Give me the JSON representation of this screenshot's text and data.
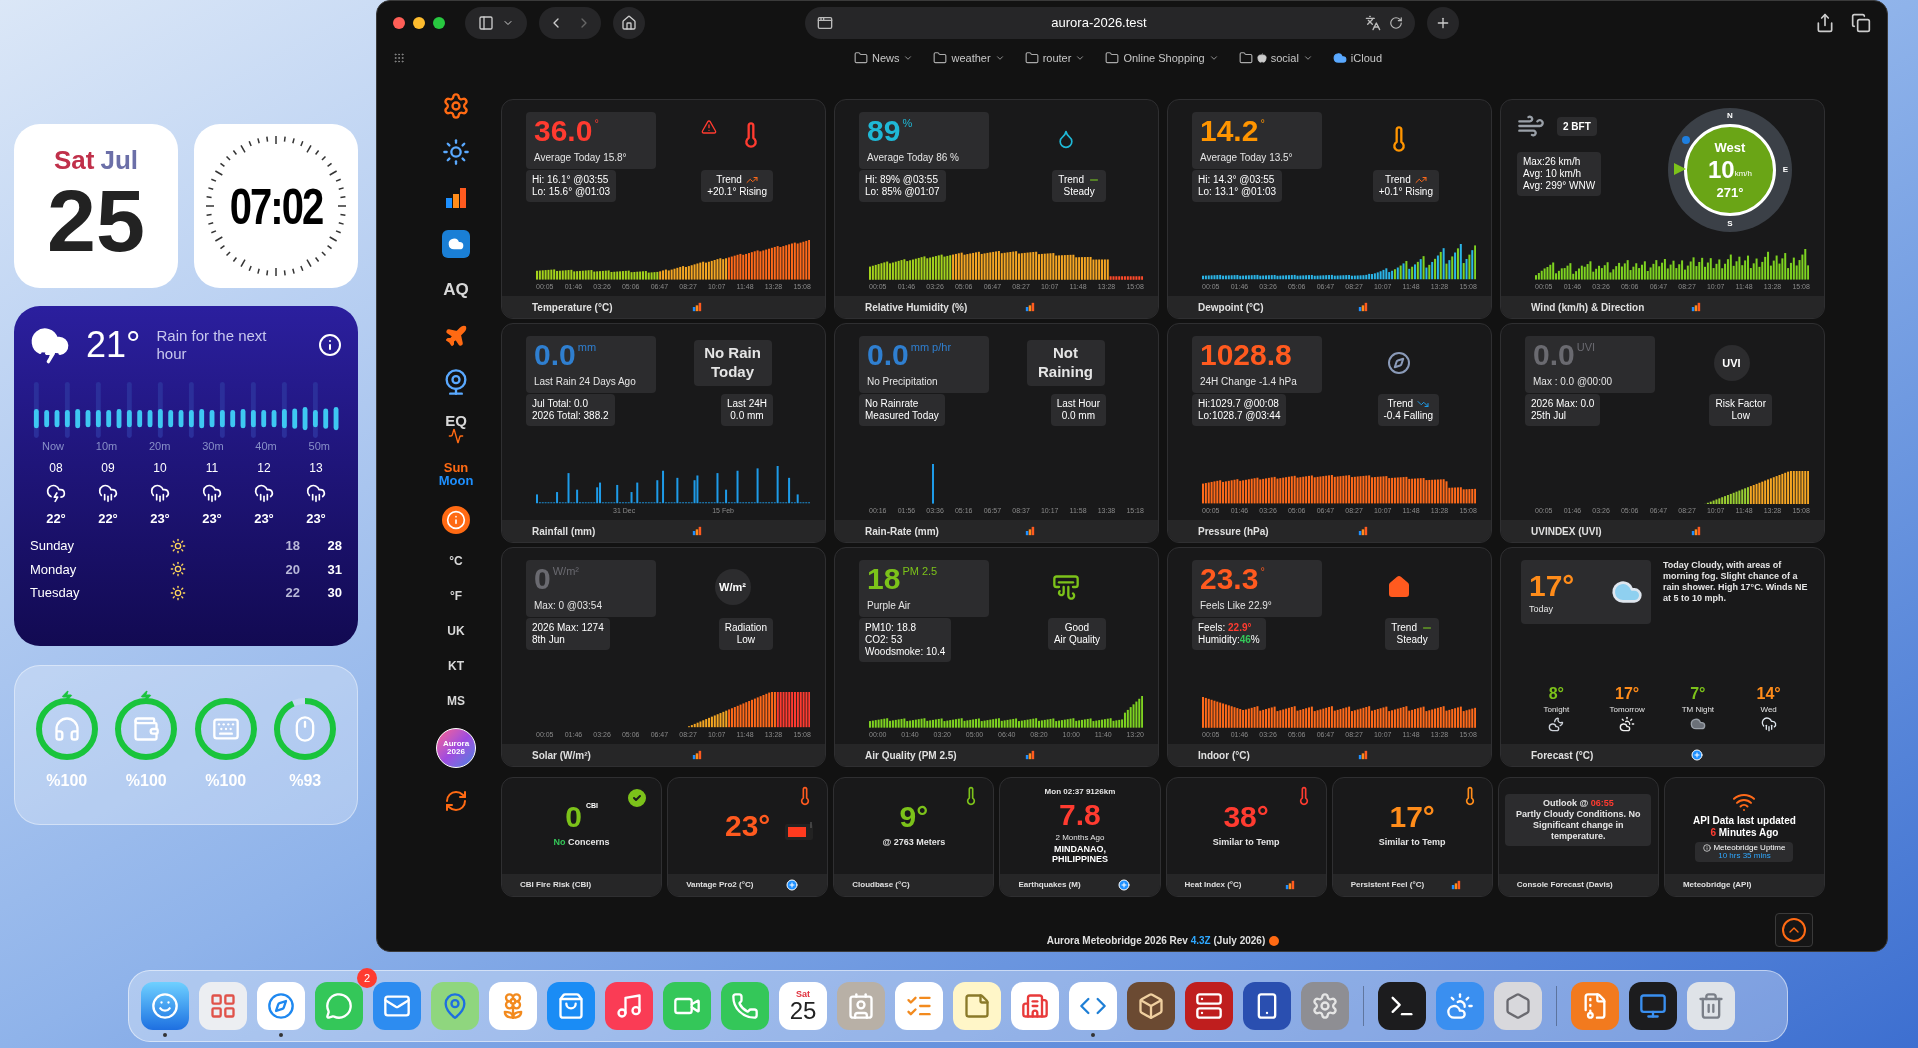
{
  "desktop": {
    "calendar_widget": {
      "weekday": "Sat",
      "month": "Jul",
      "day": "25"
    },
    "clock_widget": {
      "time": "07:02"
    },
    "weather_widget": {
      "kind": "thunder",
      "temperature": "21°",
      "summary": "Rain for the next hour",
      "minute_labels": [
        "Now",
        "10m",
        "20m",
        "30m",
        "40m",
        "50m"
      ],
      "hours": [
        {
          "hour": "08",
          "kind": "thunder",
          "temp": "22°"
        },
        {
          "hour": "09",
          "kind": "rain",
          "temp": "22°"
        },
        {
          "hour": "10",
          "kind": "rain",
          "temp": "23°"
        },
        {
          "hour": "11",
          "kind": "rain",
          "temp": "23°"
        },
        {
          "hour": "12",
          "kind": "rain",
          "temp": "23°"
        },
        {
          "hour": "13",
          "kind": "rain",
          "temp": "23°"
        }
      ],
      "days": [
        {
          "day": "Sunday",
          "kind": "sun",
          "low": "18",
          "high": "28"
        },
        {
          "day": "Monday",
          "kind": "sun",
          "low": "20",
          "high": "31"
        },
        {
          "day": "Tuesday",
          "kind": "sun",
          "low": "22",
          "high": "30"
        }
      ]
    },
    "battery_widget": {
      "devices": [
        {
          "kind": "earbuds",
          "level": 1,
          "charging": true,
          "percent": "%100"
        },
        {
          "kind": "case",
          "level": 1,
          "charging": true,
          "percent": "%100"
        },
        {
          "kind": "keyboard",
          "level": 1,
          "charging": false,
          "percent": "%100"
        },
        {
          "kind": "mouse",
          "level": 0.93,
          "charging": false,
          "percent": "%93"
        }
      ]
    }
  },
  "browser": {
    "address": "aurora-2026.test",
    "bookmarks": [
      {
        "kind": "folder",
        "label": "News"
      },
      {
        "kind": "folder",
        "label": "weather"
      },
      {
        "kind": "folder",
        "label": "router"
      },
      {
        "kind": "folder",
        "label": "Online Shopping"
      },
      {
        "kind": "apple-folder",
        "label": "social"
      },
      {
        "kind": "link",
        "label": "iCloud"
      }
    ],
    "sidebar": [
      {
        "kind": "gear"
      },
      {
        "kind": "sun"
      },
      {
        "kind": "chart"
      },
      {
        "kind": "cloud"
      },
      {
        "kind": "label",
        "text": "AQ"
      },
      {
        "kind": "plane"
      },
      {
        "kind": "camera"
      },
      {
        "kind": "quake",
        "text": "EQ"
      },
      {
        "kind": "sunmoon",
        "lines": [
          "Sun",
          "Moon"
        ]
      },
      {
        "kind": "info"
      },
      {
        "kind": "unit",
        "text": "°C"
      },
      {
        "kind": "unit",
        "text": "°F"
      },
      {
        "kind": "unit",
        "text": "UK"
      },
      {
        "kind": "unit",
        "text": "KT"
      },
      {
        "kind": "unit",
        "text": "MS"
      },
      {
        "kind": "avatar",
        "lines": [
          "Aurora",
          "2026"
        ]
      },
      {
        "kind": "refresh"
      }
    ],
    "cards": [
      {
        "kind": "main",
        "value": "36.0",
        "unit": "°",
        "color": "#ff3b30",
        "caption": "Average Today 15.8°",
        "badge": {
          "kind": "temp-alert"
        },
        "stats": [
          "Hi: 16.1° @03:55",
          "Lo: 15.6° @01:03"
        ],
        "side": {
          "kind": "trend-up",
          "lines": [
            "Trend",
            "+20.1° Rising"
          ]
        },
        "times": [
          "00:05",
          "01:46",
          "03:26",
          "05:06",
          "06:47",
          "08:27",
          "10:07",
          "11:48",
          "13:28",
          "15:08"
        ],
        "title": "Temperature (°C)"
      },
      {
        "kind": "main",
        "value": "89",
        "unit": "%",
        "color": "#1fb8d6",
        "caption": "Average Today 86 %",
        "badge": {
          "kind": "drop"
        },
        "stats": [
          "Hi: 89% @03:55",
          "Lo: 85% @01:07"
        ],
        "side": {
          "kind": "trend-flat",
          "lines": [
            "Trend",
            "Steady"
          ]
        },
        "times": [
          "00:05",
          "01:46",
          "03:26",
          "05:06",
          "06:47",
          "08:27",
          "10:07",
          "11:48",
          "13:28",
          "15:08"
        ],
        "title": "Relative Humidity (%)"
      },
      {
        "kind": "main",
        "value": "14.2",
        "unit": "°",
        "color": "#ff9500",
        "caption": "Average Today 13.5°",
        "badge": {
          "kind": "thermo"
        },
        "stats": [
          "Hi: 14.3° @03:55",
          "Lo: 13.1° @01:03"
        ],
        "side": {
          "kind": "trend-up",
          "lines": [
            "Trend",
            "+0.1° Rising"
          ]
        },
        "times": [
          "00:05",
          "01:46",
          "03:26",
          "05:06",
          "06:47",
          "08:27",
          "10:07",
          "11:48",
          "13:28",
          "15:08"
        ],
        "title": "Dewpoint (°C)"
      },
      {
        "kind": "wind",
        "beaufort": "2 BFT",
        "stats": [
          "Max:26 km/h",
          "Avg: 10 km/h",
          "Avg: 299° WNW"
        ],
        "compass": {
          "north": "N",
          "east": "E",
          "south": "S",
          "direction": "West",
          "speed": "10",
          "unit": "km/h",
          "bearing": "271°"
        },
        "times": [
          "00:05",
          "01:46",
          "03:26",
          "05:06",
          "06:47",
          "08:27",
          "10:07",
          "11:48",
          "13:28",
          "15:08"
        ],
        "title": "Wind (km/h) & Direction"
      },
      {
        "kind": "main",
        "value": "0.0",
        "unit": "mm",
        "color": "#2f7fd0",
        "caption": "Last Rain 24 Days Ago",
        "badge": {
          "kind": "box",
          "text": "No Rain Today"
        },
        "stats": [
          "Jul Total: 0.0",
          "2026 Total: 388.2"
        ],
        "side": {
          "kind": "note",
          "lines": [
            "Last 24H",
            "0.0 mm"
          ]
        },
        "times": [
          "31 Dec",
          "15 Feb"
        ],
        "title": "Rainfall (mm)"
      },
      {
        "kind": "main",
        "value": "0.0",
        "unit": "mm p/hr",
        "color": "#2f7fd0",
        "caption": "No Precipitation",
        "badge": {
          "kind": "box",
          "text": "Not Raining"
        },
        "stats": [
          "No Rainrate",
          "Measured Today"
        ],
        "side": {
          "kind": "note",
          "lines": [
            "Last Hour",
            "0.0 mm"
          ]
        },
        "times": [
          "00:16",
          "01:56",
          "03:36",
          "05:16",
          "06:57",
          "08:37",
          "10:17",
          "11:58",
          "13:38",
          "15:18"
        ],
        "title": "Rain-Rate (mm)"
      },
      {
        "kind": "main",
        "value": "1028.8",
        "color": "#ff5a1f",
        "caption": "24H Change -1.4 hPa",
        "badge": {
          "kind": "gauge"
        },
        "stats": [
          "Hi:1029.7 @00:08",
          "Lo:1028.7 @03:44"
        ],
        "side": {
          "kind": "trend-down",
          "lines": [
            "Trend",
            "-0.4 Falling"
          ]
        },
        "times": [
          "00:05",
          "01:46",
          "03:26",
          "05:06",
          "06:47",
          "08:27",
          "10:07",
          "11:48",
          "13:28",
          "15:08"
        ],
        "title": "Pressure (hPa)"
      },
      {
        "kind": "main",
        "value": "0.0",
        "unit": "UVI",
        "color": "#6a6a70",
        "caption": "Max : 0.0 @00:00",
        "badge": {
          "kind": "circle",
          "text": "UVI"
        },
        "stats": [
          "2026 Max: 0.0",
          "25th Jul"
        ],
        "side": {
          "kind": "note",
          "lines": [
            "Risk Factor",
            "Low"
          ]
        },
        "times": [
          "00:05",
          "01:46",
          "03:26",
          "05:06",
          "06:47",
          "08:27",
          "10:07",
          "11:48",
          "13:28",
          "15:08"
        ],
        "title": "UVINDEX (UVI)"
      },
      {
        "kind": "main",
        "value": "0",
        "unit": "W/m²",
        "color": "#6a6a70",
        "caption": "Max: 0 @03:54",
        "badge": {
          "kind": "circle",
          "text": "W/m²"
        },
        "stats": [
          "2026 Max: 1274",
          "8th Jun"
        ],
        "side": {
          "kind": "note",
          "lines": [
            "Radiation",
            "Low"
          ]
        },
        "times": [
          "00:05",
          "01:46",
          "03:26",
          "05:06",
          "06:47",
          "08:27",
          "10:07",
          "11:48",
          "13:28",
          "15:08"
        ],
        "title": "Solar (W/m²)"
      },
      {
        "kind": "main",
        "value": "18",
        "unit": "PM 2.5",
        "color": "#7cc21a",
        "caption": "Purple Air",
        "badge": {
          "kind": "filter"
        },
        "stats": [
          "PM10: 18.8",
          "CO2: 53",
          "Woodsmoke: 10.4"
        ],
        "side": {
          "kind": "note",
          "lines": [
            "Good",
            "Air Quality"
          ]
        },
        "times": [
          "00:00",
          "01:40",
          "03:20",
          "05:00",
          "06:40",
          "08:20",
          "10:00",
          "11:40",
          "13:20"
        ],
        "title": "Air Quality (PM 2.5)"
      },
      {
        "kind": "main",
        "value": "23.3",
        "unit": "°",
        "color": "#ff5a1f",
        "caption": "Feels Like 22.9°",
        "badge": {
          "kind": "house"
        },
        "stats": [
          [
            {
              "text": "Feels: "
            },
            {
              "text": "22.9°",
              "color": "#ff3b30"
            }
          ],
          [
            {
              "text": "Humidity:"
            },
            {
              "text": "46",
              "color": "#34c759"
            },
            {
              "text": "%"
            }
          ]
        ],
        "side": {
          "kind": "trend-flat",
          "lines": [
            "Trend",
            "Steady"
          ]
        },
        "times": [
          "00:05",
          "01:46",
          "03:26",
          "05:06",
          "06:47",
          "08:27",
          "10:07",
          "11:48",
          "13:28",
          "15:08"
        ],
        "title": "Indoor (°C)"
      },
      {
        "kind": "forecast",
        "value": "17°",
        "value_label": "Today",
        "text": "Today Cloudy, with areas of morning fog. Slight chance of a rain shower. High 17°C. Winds NE at 5 to 10 mph.",
        "periods": [
          {
            "temp": "8°",
            "color": "#7cc21a",
            "label": "Tonight",
            "kind": "moon"
          },
          {
            "temp": "17°",
            "color": "#ff8c1a",
            "label": "Tomorrow",
            "kind": "sun-cloud"
          },
          {
            "temp": "7°",
            "color": "#7cc21a",
            "label": "TM Night",
            "kind": "cloud"
          },
          {
            "temp": "14°",
            "color": "#ff8c1a",
            "label": "Wed",
            "kind": "rain"
          }
        ],
        "title": "Forecast (°C)"
      }
    ],
    "tiles": [
      {
        "kind": "reading",
        "value": "0",
        "unit": "CBI",
        "color": "#7cc21a",
        "lines": [
          [
            {
              "text": "No",
              "color": "#34c759"
            },
            {
              "text": " Concerns"
            }
          ]
        ],
        "icons": [
          {
            "kind": "check"
          }
        ],
        "title": "CBI Fire Risk (CBI)"
      },
      {
        "kind": "reading",
        "value": "23°",
        "color": "#ff5a1f",
        "icons": [
          {
            "kind": "thermo"
          },
          {
            "kind": "console"
          }
        ],
        "title": "Vantage Pro2 (°C)",
        "footer_icon": {
          "kind": "plus"
        }
      },
      {
        "kind": "reading",
        "value": "9°",
        "color": "#7cc21a",
        "lines": [
          "@ 2763 Meters"
        ],
        "icons": [
          {
            "kind": "thermo"
          }
        ],
        "title": "Cloudbase (°C)"
      },
      {
        "kind": "quake",
        "header": "Mon 02:37 9126km",
        "value": "7.8",
        "color": "#ff3b30",
        "lines": [
          "2 Months Ago"
        ],
        "place": "MINDANAO, PHILIPPINES",
        "title": "Earthquakes (M)",
        "footer_icon": {
          "kind": "plus"
        }
      },
      {
        "kind": "reading",
        "value": "38°",
        "color": "#ff3b30",
        "lines": [
          "Similar to Temp"
        ],
        "icons": [
          {
            "kind": "thermo"
          }
        ],
        "title": "Heat Index (°C)",
        "footer_icon": {
          "kind": "chart"
        }
      },
      {
        "kind": "reading",
        "value": "17°",
        "color": "#ff8c1a",
        "lines": [
          "Similar to Temp"
        ],
        "icons": [
          {
            "kind": "thermo"
          }
        ],
        "title": "Persistent Feel (°C)",
        "footer_icon": {
          "kind": "chart"
        }
      },
      {
        "kind": "outlook",
        "lines": [
          [
            {
              "text": "Outlook @ "
            },
            {
              "text": "06:55",
              "color": "#ff3b30"
            }
          ],
          "Partly Cloudy Conditions. No Significant change in temperature."
        ],
        "title": "Console Forecast (Davis)"
      },
      {
        "kind": "api",
        "lines": [
          "API Data last updated",
          [
            {
              "text": "6",
              "color": "#ff3b30"
            },
            {
              "text": " Minutes Ago"
            }
          ]
        ],
        "uptime": [
          "Meteobridge Uptime",
          "10 hrs 35 mins"
        ],
        "title": "Meteobridge (API)"
      }
    ],
    "footer": {
      "before": "Aurora Meteobridge 2026 Rev",
      "version": "4.3Z",
      "after": "(July 2026)"
    }
  },
  "dock": {
    "apps": [
      {
        "kind": "finder",
        "running": true
      },
      {
        "kind": "launchpad",
        "running": false
      },
      {
        "kind": "safari",
        "running": true
      },
      {
        "kind": "messages",
        "running": false,
        "badge": "2"
      },
      {
        "kind": "mail",
        "running": false
      },
      {
        "kind": "maps",
        "running": false
      },
      {
        "kind": "photos",
        "running": false
      },
      {
        "kind": "appstore",
        "running": false
      },
      {
        "kind": "music",
        "running": false
      },
      {
        "kind": "facetime",
        "running": false
      },
      {
        "kind": "phone",
        "running": false
      },
      {
        "kind": "calendar",
        "running": false,
        "weekday": "Sat",
        "day": "25"
      },
      {
        "kind": "contacts",
        "running": false
      },
      {
        "kind": "reminders",
        "running": false
      },
      {
        "kind": "notes",
        "running": false
      },
      {
        "kind": "happ",
        "running": false
      },
      {
        "kind": "vscode",
        "running": true
      },
      {
        "kind": "box",
        "running": false
      },
      {
        "kind": "filezilla",
        "running": false
      },
      {
        "kind": "mirroring",
        "running": false
      },
      {
        "kind": "settings",
        "running": false
      }
    ],
    "utilities": [
      {
        "kind": "terminal",
        "running": false
      },
      {
        "kind": "weather",
        "running": false
      },
      {
        "kind": "hexagon",
        "running": false
      }
    ],
    "documents": [
      {
        "kind": "archive",
        "running": false
      },
      {
        "kind": "screen",
        "running": false
      },
      {
        "kind": "trash",
        "running": false
      }
    ]
  }
}
